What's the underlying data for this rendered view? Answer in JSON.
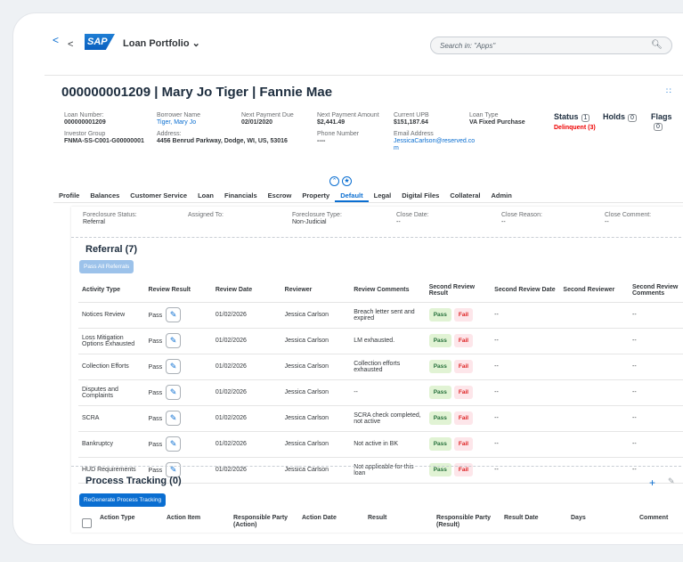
{
  "shell": {
    "back_label": "<",
    "nav_back": "<",
    "logo": "SAP",
    "app_title": "Loan Portfolio ⌄",
    "search_placeholder": "Search in: \"Apps\"",
    "search_icon": "search-icon"
  },
  "header": {
    "title": "000000001209 | Mary Jo Tiger | Fannie Mae",
    "loan_number_label": "Loan Number:",
    "loan_number": "000000001209",
    "investor_group_label": "Investor Group",
    "investor_group": "FNMA-SS-C001-G00000001",
    "borrower_name_label": "Borrower Name",
    "borrower_name": "Tiger, Mary Jo",
    "address_label": "Address:",
    "address": "4456 Benrud Parkway, Dodge, WI, US, 53016",
    "next_payment_due_label": "Next Payment Due",
    "next_payment_due": "02/01/2020",
    "next_payment_amount_label": "Next Payment Amount",
    "next_payment_amount": "$2,441.49",
    "phone_label": "Phone Number",
    "phone": "----",
    "upb_label": "Current UPB",
    "upb": "$151,187.64",
    "email_label": "Email Address",
    "email": "JessicaCarlson@reserved.co m",
    "loan_type_label": "Loan Type",
    "loan_type": "VA Fixed Purchase",
    "status_label": "Status",
    "status_count": "1",
    "status_value": "Delinquent (3)",
    "holds_label": "Holds",
    "holds_count": "0",
    "flags_label": "Flags",
    "flags_count": "0"
  },
  "tabs": [
    "Profile",
    "Balances",
    "Customer Service",
    "Loan",
    "Financials",
    "Escrow",
    "Property",
    "Default",
    "Legal",
    "Digital Files",
    "Collateral",
    "Admin"
  ],
  "active_tab": "Default",
  "foreclosure": {
    "status_label": "Foreclosure Status:",
    "status": "Referral",
    "assigned_label": "Assigned To:",
    "type_label": "Foreclosure Type:",
    "type": "Non-Judicial",
    "close_date_label": "Close Date:",
    "close_date": "--",
    "close_reason_label": "Close Reason:",
    "close_reason": "--",
    "close_comment_label": "Close Comment:",
    "close_comment": "--"
  },
  "referral": {
    "title": "Referral (7)",
    "pass_all_button": "Pass All Referrals",
    "columns": [
      "Activity Type",
      "Review Result",
      "Review Date",
      "Reviewer",
      "Review Comments",
      "Second Review Result",
      "Second Review Date",
      "Second Reviewer",
      "Second Review Comments"
    ],
    "pass_label": "Pass",
    "fail_label": "Fail",
    "rows": [
      {
        "activity": "Notices Review",
        "result": "Pass",
        "date": "01/02/2026",
        "reviewer": "Jessica Carlson",
        "comments": "Breach letter sent and expired",
        "second_date": "--",
        "second_comments": "--"
      },
      {
        "activity": "Loss Mitigation Options Exhausted",
        "result": "Pass",
        "date": "01/02/2026",
        "reviewer": "Jessica Carlson",
        "comments": "LM exhausted.",
        "second_date": "--",
        "second_comments": "--"
      },
      {
        "activity": "Collection Efforts",
        "result": "Pass",
        "date": "01/02/2026",
        "reviewer": "Jessica Carlson",
        "comments": "Collection efforts exhausted",
        "second_date": "--",
        "second_comments": "--"
      },
      {
        "activity": "Disputes and Complaints",
        "result": "Pass",
        "date": "01/02/2026",
        "reviewer": "Jessica Carlson",
        "comments": "--",
        "second_date": "--",
        "second_comments": "--"
      },
      {
        "activity": "SCRA",
        "result": "Pass",
        "date": "01/02/2026",
        "reviewer": "Jessica Carlson",
        "comments": "SCRA check completed, not active",
        "second_date": "--",
        "second_comments": "--"
      },
      {
        "activity": "Bankruptcy",
        "result": "Pass",
        "date": "01/02/2026",
        "reviewer": "Jessica Carlson",
        "comments": "Not active in BK",
        "second_date": "--",
        "second_comments": "--"
      },
      {
        "activity": "HUD Requirements",
        "result": "Pass",
        "date": "01/02/2026",
        "reviewer": "Jessica Carlson",
        "comments": "Not applicable for this loan",
        "second_date": "--",
        "second_comments": "--"
      }
    ]
  },
  "process_tracking": {
    "title": "Process Tracking (0)",
    "regenerate_button": "ReGenerate Process Tracking",
    "columns": [
      "Action Type",
      "Action Item",
      "Responsible Party (Action)",
      "Action Date",
      "Result",
      "Responsible Party (Result)",
      "Result Date",
      "Days",
      "Comment"
    ]
  }
}
